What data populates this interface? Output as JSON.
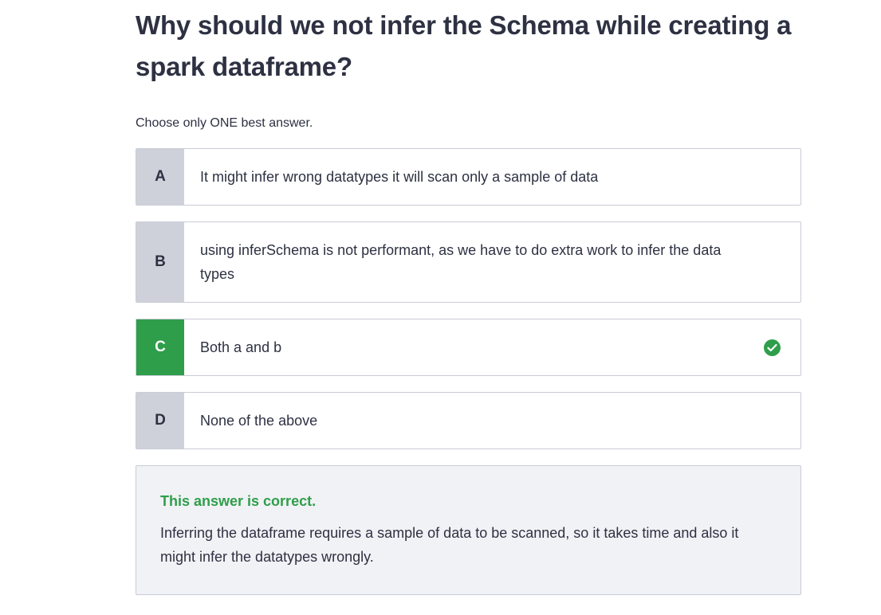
{
  "question": {
    "title": "Why should we not infer the Schema while creating a spark dataframe?",
    "instruction": "Choose only ONE best answer."
  },
  "options": [
    {
      "letter": "A",
      "text": "It might infer wrong datatypes it will scan only a sample of data"
    },
    {
      "letter": "B",
      "text": "using inferSchema is not performant, as we have to do extra work to infer the data types"
    },
    {
      "letter": "C",
      "text": "Both a and b",
      "correct": true
    },
    {
      "letter": "D",
      "text": "None of the above"
    }
  ],
  "feedback": {
    "title": "This answer is correct.",
    "body": "Inferring the dataframe requires a sample of data to be scanned, so it takes time and also it might infer the datatypes wrongly."
  },
  "icons": {
    "correct_option": "check-circle-icon"
  },
  "colors": {
    "correct_green": "#2e9e4a",
    "letter_gray": "#cfd1da",
    "text_dark": "#2d3142",
    "feedback_bg": "#f1f2f5"
  }
}
